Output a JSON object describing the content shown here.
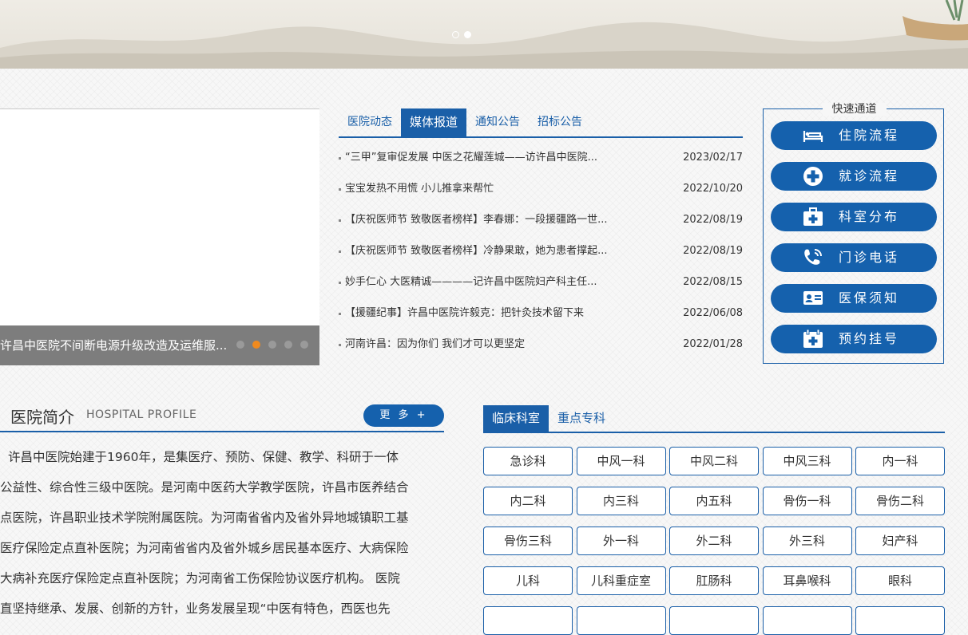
{
  "banner": {
    "dots_count": 2,
    "active_dot": 1
  },
  "slider": {
    "caption": "许昌中医院不间断电源升级改造及运维服...",
    "dots_count": 5,
    "active_dot": 1
  },
  "news": {
    "tabs": [
      "医院动态",
      "媒体报道",
      "通知公告",
      "招标公告"
    ],
    "active_tab": 1,
    "items": [
      {
        "title": "“三甲”复审促发展 中医之花耀莲城——访许昌中医院...",
        "date": "2023/02/17"
      },
      {
        "title": "宝宝发热不用慌 小儿推拿来帮忙",
        "date": "2022/10/20"
      },
      {
        "title": "【庆祝医师节 致敬医者榜样】李春娜：一段援疆路一世...",
        "date": "2022/08/19"
      },
      {
        "title": "【庆祝医师节 致敬医者榜样】冷静果敢，她为患者撑起...",
        "date": "2022/08/19"
      },
      {
        "title": "妙手仁心 大医精诚————记许昌中医院妇产科主任...",
        "date": "2022/08/15"
      },
      {
        "title": "【援疆纪事】许昌中医院许毅克：把针灸技术留下来",
        "date": "2022/06/08"
      },
      {
        "title": "河南许昌：因为你们 我们才可以更坚定",
        "date": "2022/01/28"
      }
    ]
  },
  "quick": {
    "title": "快速通道",
    "buttons": [
      {
        "label": "住院流程",
        "icon": "hospital-bed-icon"
      },
      {
        "label": "就诊流程",
        "icon": "medical-cross-icon"
      },
      {
        "label": "科室分布",
        "icon": "first-aid-kit-icon"
      },
      {
        "label": "门诊电话",
        "icon": "phone-icon"
      },
      {
        "label": "医保须知",
        "icon": "id-card-icon"
      },
      {
        "label": "预约挂号",
        "icon": "calendar-plus-icon"
      }
    ]
  },
  "profile": {
    "title": "医院简介",
    "subtitle": "HOSPITAL PROFILE",
    "more_label": "更 多 +",
    "lines": [
      "许昌中医院始建于1960年，是集医疗、预防、保健、教学、科研于一体",
      "公益性、综合性三级中医院。是河南中医药大学教学医院，许昌市医养结合",
      "点医院，许昌职业技术学院附属医院。为河南省省内及省外异地城镇职工基",
      "医疗保险定点直补医院；为河南省省内及省外城乡居民基本医疗、大病保险",
      "大病补充医疗保险定点直补医院；为河南省工伤保险协议医疗机构。 医院",
      "直坚持继承、发展、创新的方针，业务发展呈现“中医有特色，西医也先"
    ]
  },
  "departments": {
    "tabs": [
      "临床科室",
      "重点专科"
    ],
    "active_tab": 0,
    "items": [
      "急诊科",
      "中风一科",
      "中风二科",
      "中风三科",
      "内一科",
      "内二科",
      "内三科",
      "内五科",
      "骨伤一科",
      "骨伤二科",
      "骨伤三科",
      "外一科",
      "外二科",
      "外三科",
      "妇产科",
      "儿科",
      "儿科重症室",
      "肛肠科",
      "耳鼻喉科",
      "眼科",
      "",
      "",
      "",
      "",
      ""
    ]
  },
  "colors": {
    "primary": "#1561ad",
    "tab_blue": "#1a5fa8",
    "active_dot": "#f08a1e"
  }
}
